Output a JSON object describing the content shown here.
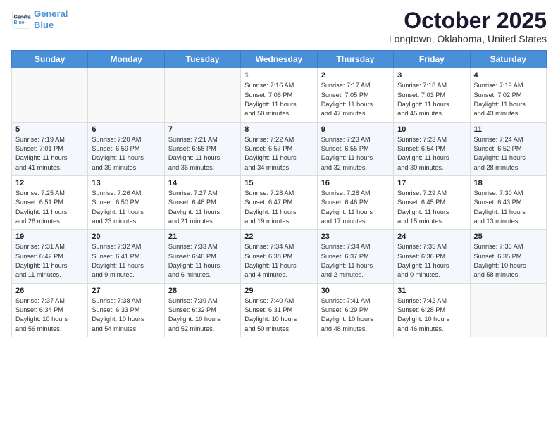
{
  "logo": {
    "line1": "General",
    "line2": "Blue"
  },
  "title": "October 2025",
  "subtitle": "Longtown, Oklahoma, United States",
  "days_of_week": [
    "Sunday",
    "Monday",
    "Tuesday",
    "Wednesday",
    "Thursday",
    "Friday",
    "Saturday"
  ],
  "weeks": [
    [
      {
        "day": null,
        "info": null
      },
      {
        "day": null,
        "info": null
      },
      {
        "day": null,
        "info": null
      },
      {
        "day": "1",
        "info": "Sunrise: 7:16 AM\nSunset: 7:06 PM\nDaylight: 11 hours\nand 50 minutes."
      },
      {
        "day": "2",
        "info": "Sunrise: 7:17 AM\nSunset: 7:05 PM\nDaylight: 11 hours\nand 47 minutes."
      },
      {
        "day": "3",
        "info": "Sunrise: 7:18 AM\nSunset: 7:03 PM\nDaylight: 11 hours\nand 45 minutes."
      },
      {
        "day": "4",
        "info": "Sunrise: 7:19 AM\nSunset: 7:02 PM\nDaylight: 11 hours\nand 43 minutes."
      }
    ],
    [
      {
        "day": "5",
        "info": "Sunrise: 7:19 AM\nSunset: 7:01 PM\nDaylight: 11 hours\nand 41 minutes."
      },
      {
        "day": "6",
        "info": "Sunrise: 7:20 AM\nSunset: 6:59 PM\nDaylight: 11 hours\nand 39 minutes."
      },
      {
        "day": "7",
        "info": "Sunrise: 7:21 AM\nSunset: 6:58 PM\nDaylight: 11 hours\nand 36 minutes."
      },
      {
        "day": "8",
        "info": "Sunrise: 7:22 AM\nSunset: 6:57 PM\nDaylight: 11 hours\nand 34 minutes."
      },
      {
        "day": "9",
        "info": "Sunrise: 7:23 AM\nSunset: 6:55 PM\nDaylight: 11 hours\nand 32 minutes."
      },
      {
        "day": "10",
        "info": "Sunrise: 7:23 AM\nSunset: 6:54 PM\nDaylight: 11 hours\nand 30 minutes."
      },
      {
        "day": "11",
        "info": "Sunrise: 7:24 AM\nSunset: 6:52 PM\nDaylight: 11 hours\nand 28 minutes."
      }
    ],
    [
      {
        "day": "12",
        "info": "Sunrise: 7:25 AM\nSunset: 6:51 PM\nDaylight: 11 hours\nand 26 minutes."
      },
      {
        "day": "13",
        "info": "Sunrise: 7:26 AM\nSunset: 6:50 PM\nDaylight: 11 hours\nand 23 minutes."
      },
      {
        "day": "14",
        "info": "Sunrise: 7:27 AM\nSunset: 6:48 PM\nDaylight: 11 hours\nand 21 minutes."
      },
      {
        "day": "15",
        "info": "Sunrise: 7:28 AM\nSunset: 6:47 PM\nDaylight: 11 hours\nand 19 minutes."
      },
      {
        "day": "16",
        "info": "Sunrise: 7:28 AM\nSunset: 6:46 PM\nDaylight: 11 hours\nand 17 minutes."
      },
      {
        "day": "17",
        "info": "Sunrise: 7:29 AM\nSunset: 6:45 PM\nDaylight: 11 hours\nand 15 minutes."
      },
      {
        "day": "18",
        "info": "Sunrise: 7:30 AM\nSunset: 6:43 PM\nDaylight: 11 hours\nand 13 minutes."
      }
    ],
    [
      {
        "day": "19",
        "info": "Sunrise: 7:31 AM\nSunset: 6:42 PM\nDaylight: 11 hours\nand 11 minutes."
      },
      {
        "day": "20",
        "info": "Sunrise: 7:32 AM\nSunset: 6:41 PM\nDaylight: 11 hours\nand 9 minutes."
      },
      {
        "day": "21",
        "info": "Sunrise: 7:33 AM\nSunset: 6:40 PM\nDaylight: 11 hours\nand 6 minutes."
      },
      {
        "day": "22",
        "info": "Sunrise: 7:34 AM\nSunset: 6:38 PM\nDaylight: 11 hours\nand 4 minutes."
      },
      {
        "day": "23",
        "info": "Sunrise: 7:34 AM\nSunset: 6:37 PM\nDaylight: 11 hours\nand 2 minutes."
      },
      {
        "day": "24",
        "info": "Sunrise: 7:35 AM\nSunset: 6:36 PM\nDaylight: 11 hours\nand 0 minutes."
      },
      {
        "day": "25",
        "info": "Sunrise: 7:36 AM\nSunset: 6:35 PM\nDaylight: 10 hours\nand 58 minutes."
      }
    ],
    [
      {
        "day": "26",
        "info": "Sunrise: 7:37 AM\nSunset: 6:34 PM\nDaylight: 10 hours\nand 56 minutes."
      },
      {
        "day": "27",
        "info": "Sunrise: 7:38 AM\nSunset: 6:33 PM\nDaylight: 10 hours\nand 54 minutes."
      },
      {
        "day": "28",
        "info": "Sunrise: 7:39 AM\nSunset: 6:32 PM\nDaylight: 10 hours\nand 52 minutes."
      },
      {
        "day": "29",
        "info": "Sunrise: 7:40 AM\nSunset: 6:31 PM\nDaylight: 10 hours\nand 50 minutes."
      },
      {
        "day": "30",
        "info": "Sunrise: 7:41 AM\nSunset: 6:29 PM\nDaylight: 10 hours\nand 48 minutes."
      },
      {
        "day": "31",
        "info": "Sunrise: 7:42 AM\nSunset: 6:28 PM\nDaylight: 10 hours\nand 46 minutes."
      },
      {
        "day": null,
        "info": null
      }
    ]
  ]
}
